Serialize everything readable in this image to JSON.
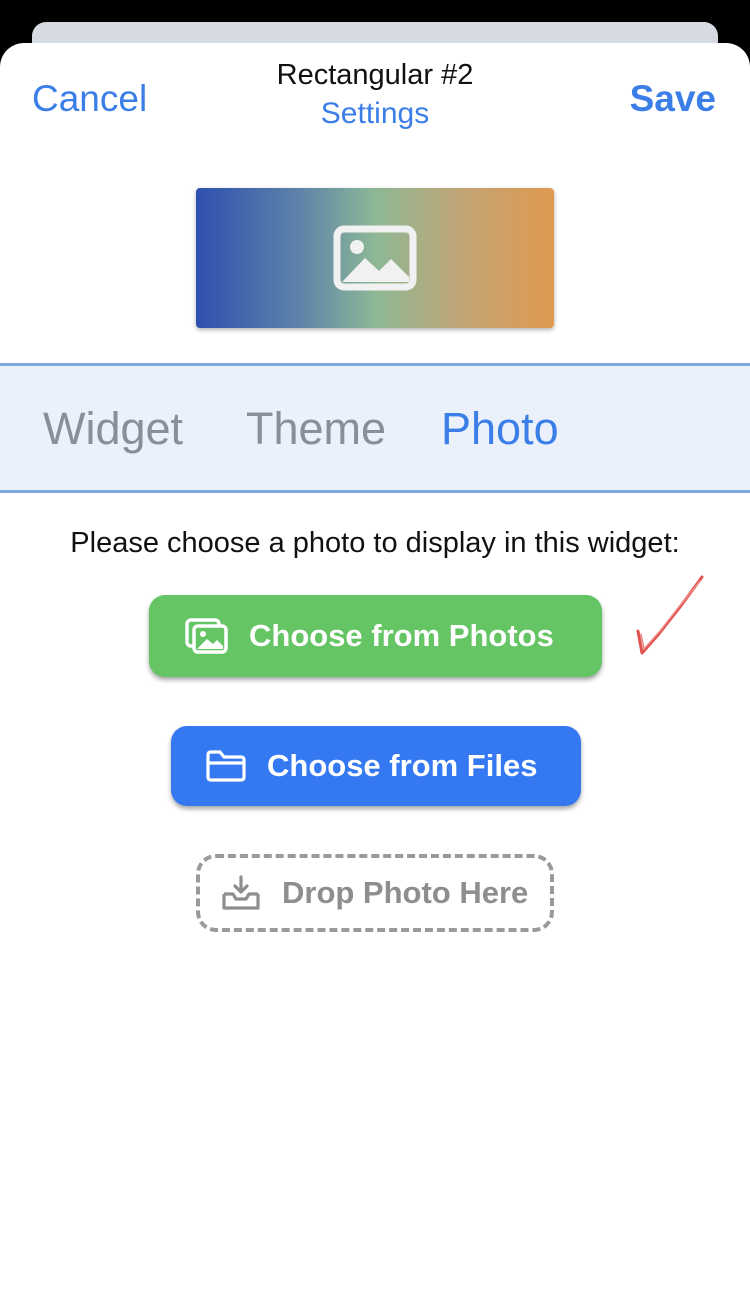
{
  "nav": {
    "cancel_label": "Cancel",
    "title": "Rectangular #2",
    "subtitle": "Settings",
    "save_label": "Save"
  },
  "preview": {
    "icon": "image-placeholder-icon"
  },
  "tabs": [
    {
      "label": "Widget",
      "selected": false
    },
    {
      "label": "Theme",
      "selected": false
    },
    {
      "label": "Photo",
      "selected": true
    }
  ],
  "photo_panel": {
    "prompt": "Please choose a photo to display in this widget:",
    "choose_photos_label": "Choose from Photos",
    "choose_files_label": "Choose from Files",
    "drop_label": "Drop Photo Here"
  },
  "colors": {
    "accent": "#3b7ee8",
    "photos_button": "#65c565",
    "files_button": "#3478f2",
    "annotation_check": "#e0524c"
  }
}
